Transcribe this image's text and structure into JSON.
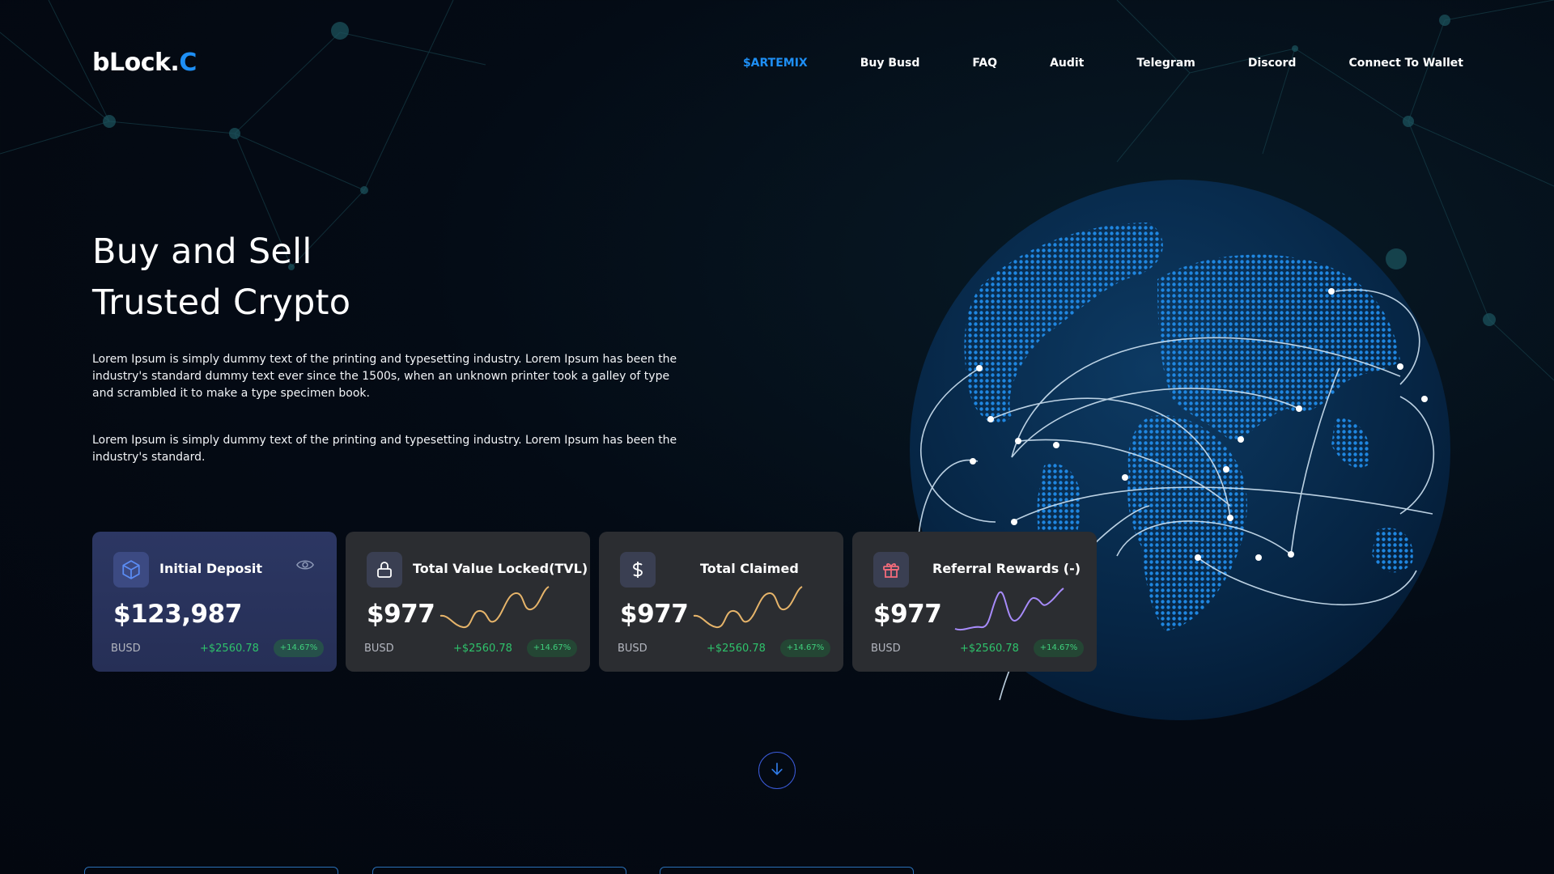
{
  "brand": {
    "name_main": "bLock.",
    "name_accent": "C",
    "accent_color": "#1e8ff5"
  },
  "nav": {
    "items": [
      {
        "label": "$ARTEMIX",
        "active": true
      },
      {
        "label": "Buy Busd"
      },
      {
        "label": "FAQ"
      },
      {
        "label": "Audit"
      },
      {
        "label": "Telegram"
      },
      {
        "label": "Discord"
      },
      {
        "label": "Connect To Wallet"
      }
    ]
  },
  "hero": {
    "title_line1": "Buy and Sell",
    "title_line2": "Trusted Crypto",
    "paragraph1": "Lorem Ipsum is simply dummy text of the printing and typesetting industry. Lorem Ipsum has been the industry's standard dummy text ever since the 1500s, when an unknown printer took a galley of type and scrambled it to make a type specimen book.",
    "paragraph2": "Lorem Ipsum is simply dummy text of the printing and typesetting industry. Lorem Ipsum has been the industry's standard."
  },
  "cards": [
    {
      "icon": "cube-icon",
      "title": "Initial Deposit",
      "value": "$123,987",
      "unit": "BUSD",
      "delta": "+$2560.78",
      "pct": "+14.67%",
      "extra_icon": "eye-icon"
    },
    {
      "icon": "lock-icon",
      "title": "Total Value Locked(TVL)",
      "value": "$977",
      "unit": "BUSD",
      "delta": "+$2560.78",
      "pct": "+14.67%",
      "spark_color": "#e6b46a"
    },
    {
      "icon": "dollar-icon",
      "title": "Total Claimed",
      "value": "$977",
      "unit": "BUSD",
      "delta": "+$2560.78",
      "pct": "+14.67%",
      "spark_color": "#e6b46a"
    },
    {
      "icon": "gift-icon",
      "title": "Referral Rewards (-)",
      "value": "$977",
      "unit": "BUSD",
      "delta": "+$2560.78",
      "pct": "+14.67%",
      "spark_color": "#a78bfa"
    }
  ],
  "scroll": {
    "icon": "arrow-down-icon"
  },
  "colors": {
    "positive": "#2ec26b",
    "globe": "#1a7fd6",
    "card_bg": "#2b2d31",
    "primary_card_bg": "#2c3763"
  }
}
